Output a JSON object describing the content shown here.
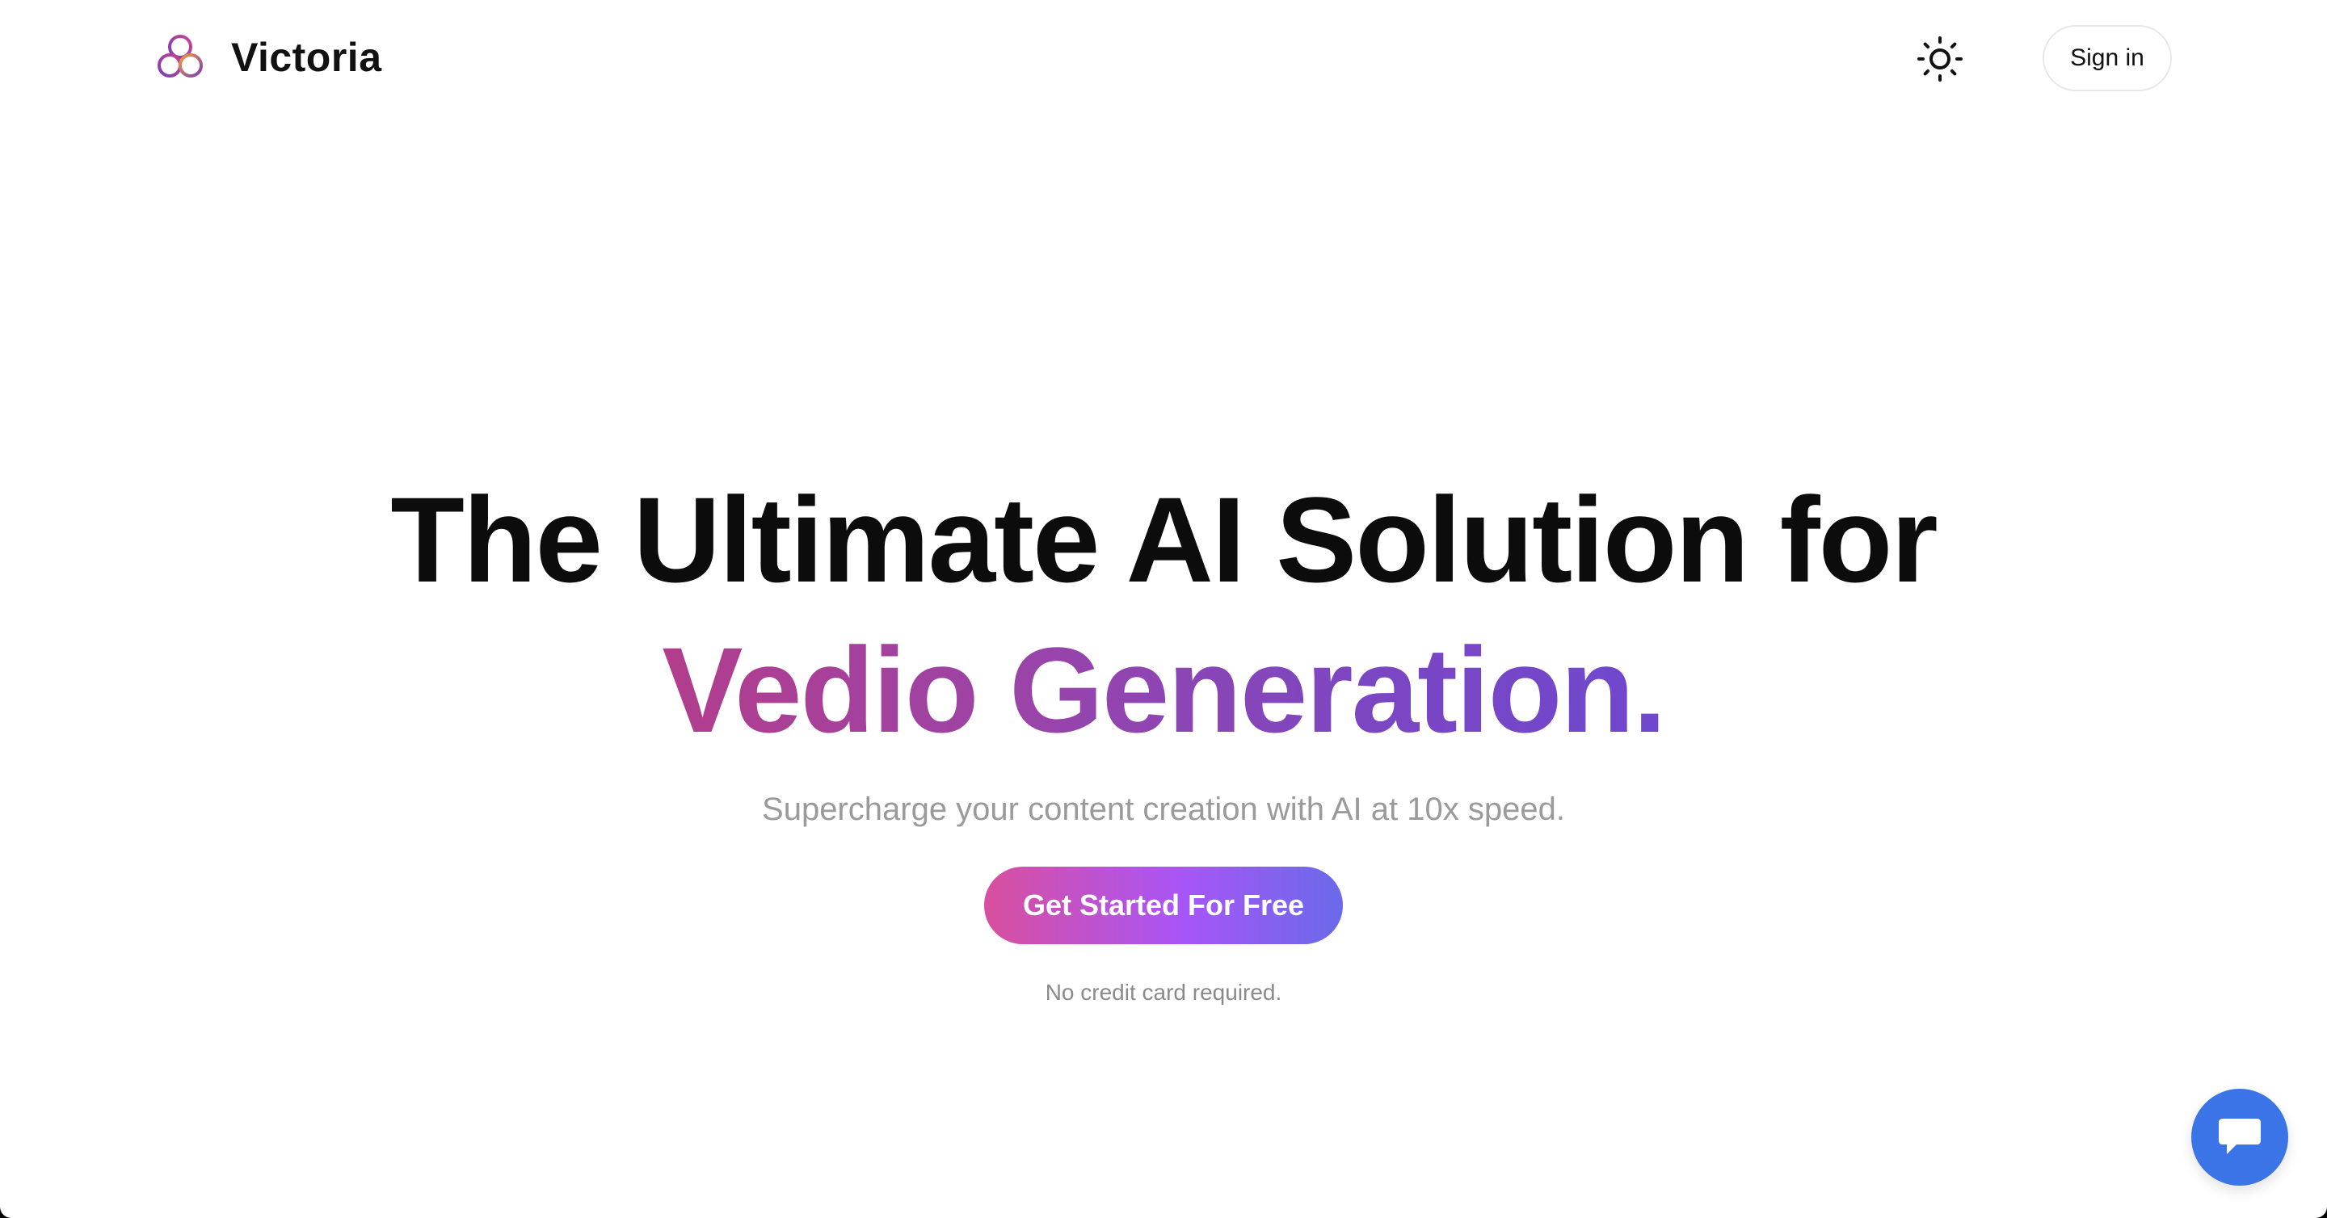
{
  "header": {
    "brand_name": "Victoria",
    "logo_icon": "triple-ring-logo-icon",
    "theme_toggle_icon": "sun-icon",
    "signin_label": "Sign in"
  },
  "hero": {
    "title_line1": "The Ultimate AI Solution for",
    "title_line2": "Vedio Generation.",
    "subtitle": "Supercharge your content creation with AI at 10x speed.",
    "cta_label": "Get Started For Free",
    "note": "No credit card required."
  },
  "chat": {
    "icon": "chat-bubble-icon"
  },
  "colors": {
    "gradient_start": "#b23d8c",
    "gradient_end": "#6f48cf",
    "cta_start": "#d84f9d",
    "cta_end": "#6a6ae9",
    "chat_button": "#3b74e6"
  }
}
